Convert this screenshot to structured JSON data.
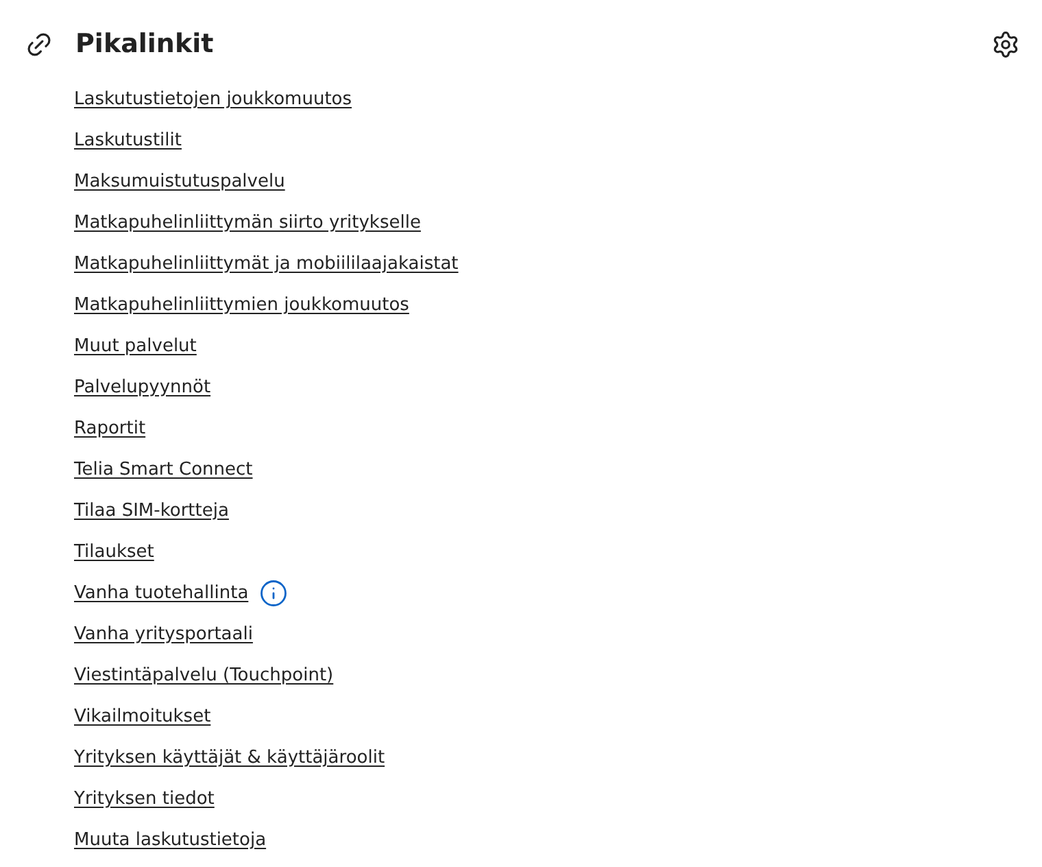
{
  "title": "Pikalinkit",
  "links": [
    {
      "label": "Laskutustietojen joukkomuutos",
      "info": false
    },
    {
      "label": "Laskutustilit",
      "info": false
    },
    {
      "label": "Maksumuistutuspalvelu",
      "info": false
    },
    {
      "label": "Matkapuhelinliittymän siirto yritykselle",
      "info": false
    },
    {
      "label": "Matkapuhelinliittymät ja mobiililaajakaistat",
      "info": false
    },
    {
      "label": "Matkapuhelinliittymien joukkomuutos",
      "info": false
    },
    {
      "label": "Muut palvelut",
      "info": false
    },
    {
      "label": "Palvelupyynnöt",
      "info": false
    },
    {
      "label": "Raportit",
      "info": false
    },
    {
      "label": "Telia Smart Connect",
      "info": false
    },
    {
      "label": "Tilaa SIM-kortteja",
      "info": false
    },
    {
      "label": "Tilaukset",
      "info": false
    },
    {
      "label": "Vanha tuotehallinta",
      "info": true
    },
    {
      "label": "Vanha yritysportaali",
      "info": false
    },
    {
      "label": "Viestintäpalvelu (Touchpoint)",
      "info": false
    },
    {
      "label": "Vikailmoitukset",
      "info": false
    },
    {
      "label": "Yrityksen käyttäjät & käyttäjäroolit",
      "info": false
    },
    {
      "label": "Yrityksen tiedot",
      "info": false
    },
    {
      "label": "Muuta laskutustietoja",
      "info": false
    }
  ]
}
